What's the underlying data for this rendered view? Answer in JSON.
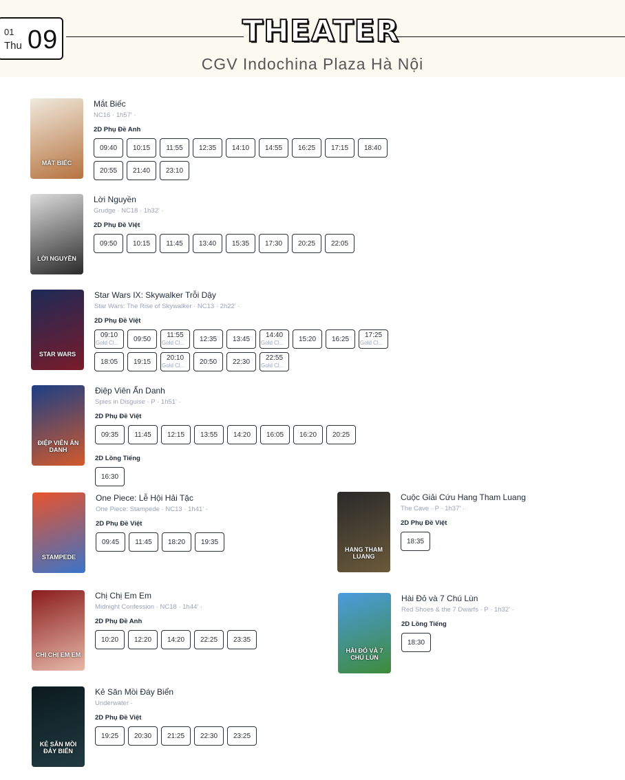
{
  "header": {
    "date_month": "01",
    "date_weekday": "Thu",
    "date_day": "09",
    "title": "THEATER",
    "cinema": "CGV Indochina Plaza Hà Nội"
  },
  "movies": [
    {
      "title": "Mắt Biếc",
      "meta": "NC16 · 1h57' ·",
      "poster_text": "MẮT BIẾC",
      "poster_colors": [
        "#efe9dc",
        "#b6733f"
      ],
      "sessions": [
        {
          "format": "2D Phụ Đề Anh",
          "times": [
            {
              "t": "09:40"
            },
            {
              "t": "10:15"
            },
            {
              "t": "11:55"
            },
            {
              "t": "12:35"
            },
            {
              "t": "14:10"
            },
            {
              "t": "14:55"
            },
            {
              "t": "16:25"
            },
            {
              "t": "17:15"
            },
            {
              "t": "18:40"
            },
            {
              "t": "20:55"
            },
            {
              "t": "21:40"
            },
            {
              "t": "23:10"
            }
          ]
        }
      ]
    },
    {
      "title": "Lời Nguyền",
      "meta": "Grudge · NC18 · 1h32' ·",
      "poster_text": "LỜI NGUYỀN",
      "poster_colors": [
        "#dcdcdc",
        "#2a2a2a"
      ],
      "sessions": [
        {
          "format": "2D Phụ Đề Việt",
          "times": [
            {
              "t": "09:50"
            },
            {
              "t": "10:15"
            },
            {
              "t": "11:45"
            },
            {
              "t": "13:40"
            },
            {
              "t": "15:35"
            },
            {
              "t": "17:30"
            },
            {
              "t": "20:25"
            },
            {
              "t": "22:05"
            }
          ]
        }
      ]
    },
    {
      "title": "Star Wars IX: Skywalker Trỗi Dậy",
      "meta": "Star Wars: The Rise of Skywalker · NC13 · 2h22' ·",
      "poster_text": "STAR WARS",
      "poster_colors": [
        "#1d2a57",
        "#7a1b2a"
      ],
      "sessions": [
        {
          "format": "2D Phụ Đề Việt",
          "times": [
            {
              "t": "09:10",
              "sub": "Gold Cl..."
            },
            {
              "t": "09:50"
            },
            {
              "t": "11:55",
              "sub": "Gold Cl..."
            },
            {
              "t": "12:35"
            },
            {
              "t": "13:45"
            },
            {
              "t": "14:40",
              "sub": "Gold Cl..."
            },
            {
              "t": "15:20"
            },
            {
              "t": "16:25"
            },
            {
              "t": "17:25",
              "sub": "Gold Cl..."
            },
            {
              "t": "18:05"
            },
            {
              "t": "19:15"
            },
            {
              "t": "20:10",
              "sub": "Gold Cl..."
            },
            {
              "t": "20:50"
            },
            {
              "t": "22:30"
            },
            {
              "t": "22:55",
              "sub": "Gold Cl..."
            }
          ]
        }
      ]
    },
    {
      "title": "Điệp Viên Ẩn Danh",
      "meta": "Spies in Disguise · P · 1h51' ·",
      "poster_text": "ĐIỆP VIÊN ẨN DANH",
      "poster_colors": [
        "#1b3f86",
        "#d25a2b"
      ],
      "sessions": [
        {
          "format": "2D Phụ Đề Việt",
          "times": [
            {
              "t": "09:35"
            },
            {
              "t": "11:45"
            },
            {
              "t": "12:15"
            },
            {
              "t": "13:55"
            },
            {
              "t": "14:20"
            },
            {
              "t": "16:05"
            },
            {
              "t": "16:20"
            },
            {
              "t": "20:25"
            }
          ]
        },
        {
          "format": "2D Lồng Tiếng",
          "times": [
            {
              "t": "16:30"
            }
          ]
        }
      ]
    },
    {
      "title": "One Piece: Lễ Hội Hải Tặc",
      "meta": "One Piece: Stampede · NC13 · 1h41' ·",
      "poster_text": "STAMPEDE",
      "poster_colors": [
        "#e8532c",
        "#3a74c9"
      ],
      "sessions": [
        {
          "format": "2D Phụ Đề Việt",
          "times": [
            {
              "t": "09:45"
            },
            {
              "t": "11:45"
            },
            {
              "t": "18:20"
            },
            {
              "t": "19:35"
            }
          ]
        }
      ]
    },
    {
      "title": "Cuộc Giải Cứu Hang Tham Luang",
      "meta": "The Cave · P · 1h37' ·",
      "poster_text": "HANG THAM LUANG",
      "poster_colors": [
        "#2a2a2a",
        "#6b5a3a"
      ],
      "sessions": [
        {
          "format": "2D Phụ Đề Việt",
          "times": [
            {
              "t": "18:35"
            }
          ]
        }
      ]
    },
    {
      "title": "Chị Chị Em Em",
      "meta": "Midnight Confession · NC18 · 1h44' ·",
      "poster_text": "CHỊ CHỊ EM EM",
      "poster_colors": [
        "#8a1d1d",
        "#e6b9a8"
      ],
      "sessions": [
        {
          "format": "2D Phụ Đề Anh",
          "times": [
            {
              "t": "10:20"
            },
            {
              "t": "12:20"
            },
            {
              "t": "14:20"
            },
            {
              "t": "22:25"
            },
            {
              "t": "23:35"
            }
          ]
        }
      ]
    },
    {
      "title": "Hài Đỏ và 7 Chú Lùn",
      "meta": "Red Shoes & the 7 Dwarfs · P · 1h32' ·",
      "poster_text": "HÀI ĐỎ VÀ 7 CHÚ LÙN",
      "poster_colors": [
        "#4a9be0",
        "#3e8b3a"
      ],
      "sessions": [
        {
          "format": "2D Lồng Tiếng",
          "times": [
            {
              "t": "18:30"
            }
          ]
        }
      ]
    },
    {
      "title": "Kẻ Săn Mồi Đáy Biển",
      "meta": "Underwater ·",
      "poster_text": "KẺ SĂN MỒI ĐÁY BIỂN",
      "poster_colors": [
        "#0b1a1f",
        "#203a40"
      ],
      "sessions": [
        {
          "format": "2D Phụ Đề Việt",
          "times": [
            {
              "t": "19:25"
            },
            {
              "t": "20:30"
            },
            {
              "t": "21:25"
            },
            {
              "t": "22:30"
            },
            {
              "t": "23:25"
            }
          ]
        }
      ]
    }
  ]
}
